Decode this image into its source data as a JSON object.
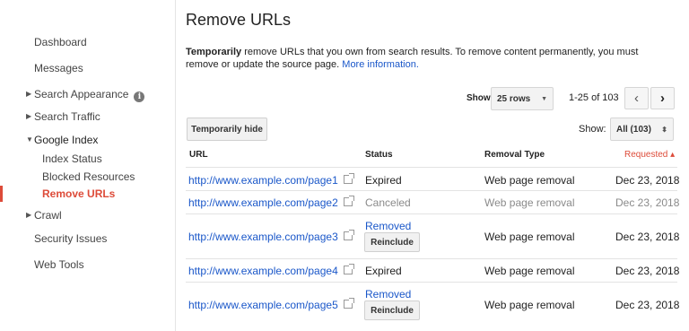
{
  "sidebar": {
    "items": [
      {
        "label": "Dashboard"
      },
      {
        "label": "Messages"
      },
      {
        "label": "Search Appearance"
      },
      {
        "label": "Search Traffic"
      },
      {
        "label": "Google Index"
      },
      {
        "label": "Index Status"
      },
      {
        "label": "Blocked Resources"
      },
      {
        "label": "Remove URLs"
      },
      {
        "label": "Crawl"
      },
      {
        "label": "Security Issues"
      },
      {
        "label": "Web Tools"
      }
    ],
    "info_glyph": "i"
  },
  "page": {
    "title": "Remove URLs",
    "intro_bold": "Temporarily",
    "intro_text": " remove URLs that you own from search results. To remove content permanently, you must remove or update the source page. ",
    "intro_link": "More information."
  },
  "toolbar": {
    "show_label": "Show",
    "rows_value": "25 rows",
    "range": "1-25 of 103",
    "prev_glyph": "‹",
    "next_glyph": "›",
    "hide_button": "Temporarily hide",
    "filter_label": "Show:",
    "filter_value": "All (103)"
  },
  "table": {
    "headers": {
      "url": "URL",
      "status": "Status",
      "type": "Removal Type",
      "requested": "Requested ▴"
    },
    "rows": [
      {
        "url": "http://www.example.com/page1",
        "status": "Expired",
        "type": "Web page removal",
        "date": "Dec 23, 2018"
      },
      {
        "url": "http://www.example.com/page2",
        "status": "Canceled",
        "type": "Web page removal",
        "date": "Dec 23, 2018"
      },
      {
        "url": "http://www.example.com/page3",
        "status": "Removed",
        "action": "Reinclude",
        "type": "Web page removal",
        "date": "Dec 23, 2018"
      },
      {
        "url": "http://www.example.com/page4",
        "status": "Expired",
        "type": "Web page removal",
        "date": "Dec 23, 2018"
      },
      {
        "url": "http://www.example.com/page5",
        "status": "Removed",
        "action": "Reinclude",
        "type": "Web page removal",
        "date": "Dec 23, 2018"
      }
    ]
  },
  "colors": {
    "link": "#1a57c9",
    "accent": "#dd4b39",
    "muted": "#8a8a8a"
  }
}
